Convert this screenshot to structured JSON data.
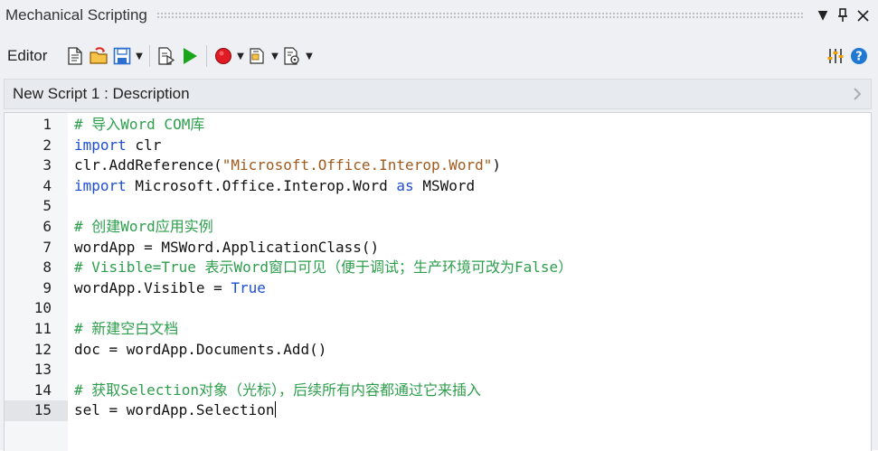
{
  "window": {
    "title": "Mechanical Scripting"
  },
  "toolbar": {
    "editor_label": "Editor"
  },
  "description": {
    "text": "New Script 1 : Description"
  },
  "editor": {
    "current_line": 15,
    "lines": [
      {
        "n": "1",
        "tokens": [
          {
            "t": "# 导入Word COM库",
            "c": "cm"
          }
        ]
      },
      {
        "n": "2",
        "tokens": [
          {
            "t": "import",
            "c": "kw"
          },
          {
            "t": " clr",
            "c": ""
          }
        ]
      },
      {
        "n": "3",
        "tokens": [
          {
            "t": "clr.AddReference(",
            "c": ""
          },
          {
            "t": "\"Microsoft.Office.Interop.Word\"",
            "c": "st"
          },
          {
            "t": ")",
            "c": ""
          }
        ]
      },
      {
        "n": "4",
        "tokens": [
          {
            "t": "import",
            "c": "kw"
          },
          {
            "t": " Microsoft.Office.Interop.Word ",
            "c": ""
          },
          {
            "t": "as",
            "c": "kw"
          },
          {
            "t": " MSWord",
            "c": ""
          }
        ]
      },
      {
        "n": "5",
        "tokens": []
      },
      {
        "n": "6",
        "tokens": [
          {
            "t": "# 创建Word应用实例",
            "c": "cm"
          }
        ]
      },
      {
        "n": "7",
        "tokens": [
          {
            "t": "wordApp = MSWord.ApplicationClass()",
            "c": ""
          }
        ]
      },
      {
        "n": "8",
        "tokens": [
          {
            "t": "# Visible=True 表示Word窗口可见（便于调试；生产环境可改为False）",
            "c": "cm"
          }
        ]
      },
      {
        "n": "9",
        "tokens": [
          {
            "t": "wordApp.Visible = ",
            "c": ""
          },
          {
            "t": "True",
            "c": "kw"
          }
        ]
      },
      {
        "n": "10",
        "tokens": []
      },
      {
        "n": "11",
        "tokens": [
          {
            "t": "# 新建空白文档",
            "c": "cm"
          }
        ]
      },
      {
        "n": "12",
        "tokens": [
          {
            "t": "doc = wordApp.Documents.Add()",
            "c": ""
          }
        ]
      },
      {
        "n": "13",
        "tokens": []
      },
      {
        "n": "14",
        "tokens": [
          {
            "t": "# 获取Selection对象（光标），后续所有内容都通过它来插入",
            "c": "cm"
          }
        ]
      },
      {
        "n": "15",
        "tokens": [
          {
            "t": "sel = wordApp.Selection",
            "c": ""
          }
        ]
      }
    ]
  },
  "colors": {
    "comment": "#2e9e4d",
    "keyword": "#1f4fd1",
    "string": "#a05a1e",
    "run_icon": "#1aa61a",
    "record_icon": "#e01b24",
    "help_icon": "#1f78d1"
  }
}
